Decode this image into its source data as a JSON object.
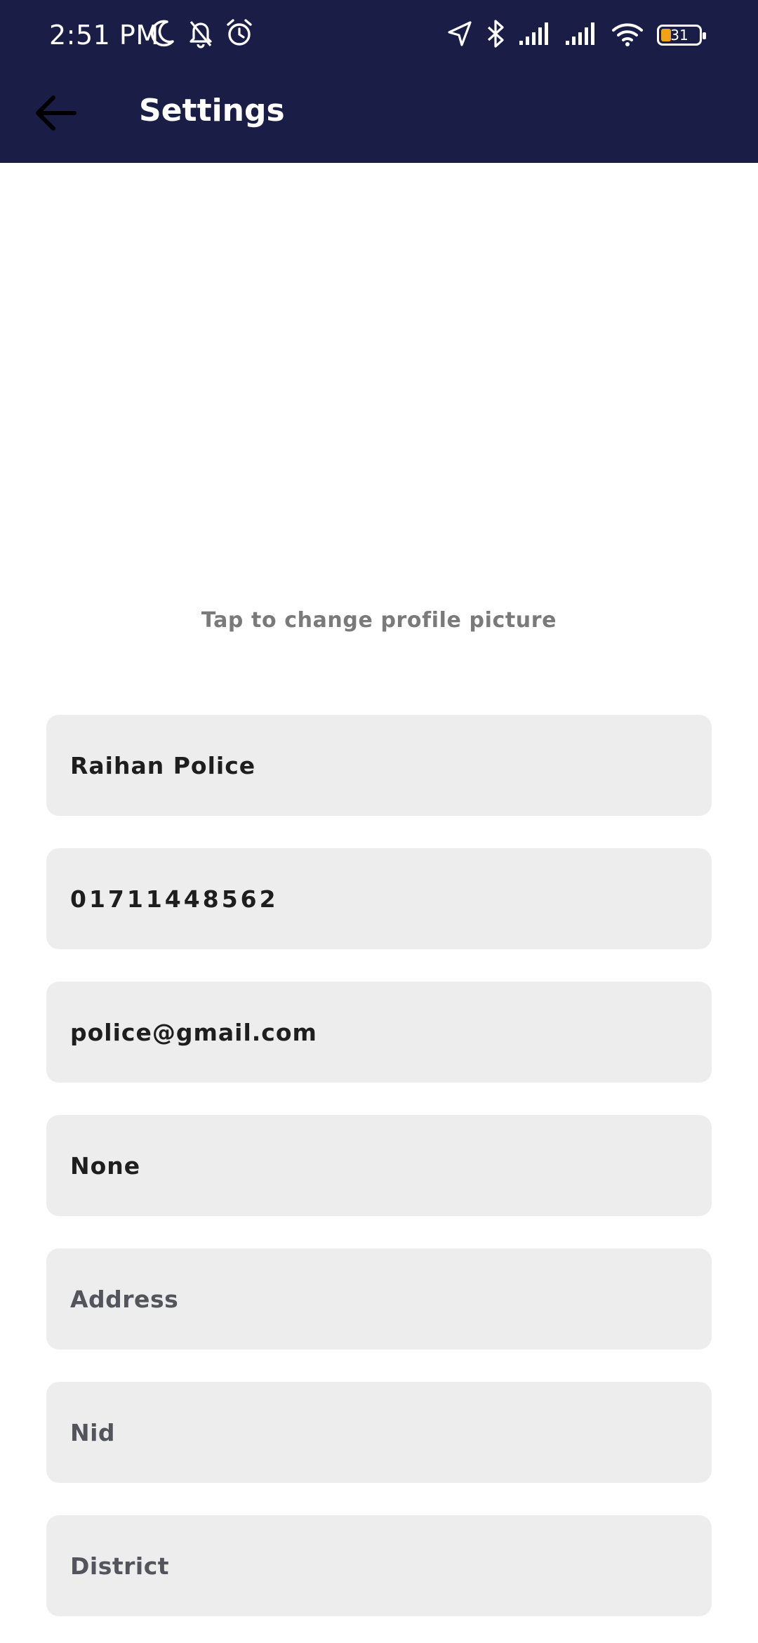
{
  "status_bar": {
    "time": "2:51 PM",
    "battery_level": "31",
    "left_icons": [
      "moon-icon",
      "bell-off-icon",
      "alarm-icon"
    ],
    "right_icons": [
      "location-arrow-icon",
      "bluetooth-icon",
      "signal-icon",
      "signal-icon",
      "wifi-icon",
      "battery-icon"
    ],
    "battery_accent": "#f0a21b"
  },
  "header": {
    "title": "Settings",
    "back_icon": "arrow-left-icon",
    "background": "#1a1e47"
  },
  "profile": {
    "tap_hint": "Tap to change profile picture"
  },
  "form": {
    "name": "Raihan Police",
    "phone": "01711448562",
    "email": "police@gmail.com",
    "other": "None",
    "address_placeholder": "Address",
    "nid_placeholder": "Nid",
    "district_placeholder": "District"
  }
}
